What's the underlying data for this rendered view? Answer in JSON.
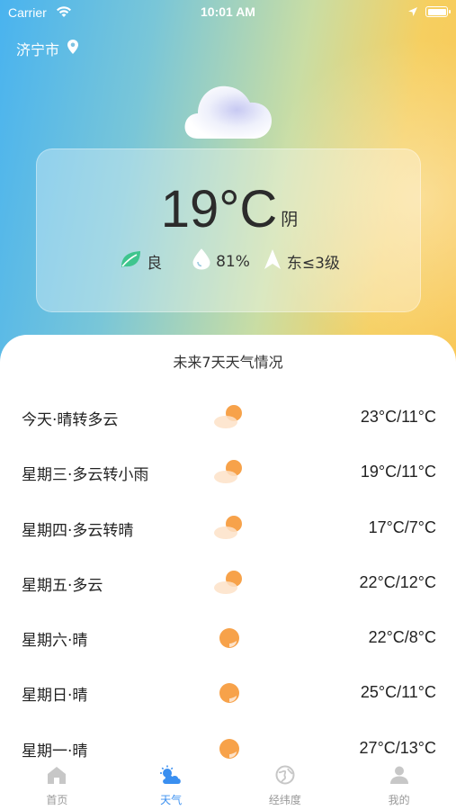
{
  "status_bar": {
    "carrier": "Carrier",
    "time": "10:01 AM"
  },
  "location": {
    "city": "济宁市",
    "icon": "location-pin-icon"
  },
  "current": {
    "temperature": "19°C",
    "condition": "阴",
    "air_quality": "良",
    "humidity": "81%",
    "wind": "东≤3级",
    "icon": "cloud-icon"
  },
  "forecast": {
    "title": "未来7天天气情况",
    "days": [
      {
        "label": "今天·晴转多云",
        "temps": "23°C/11°C",
        "icon": "sun-cloud-icon"
      },
      {
        "label": "星期三·多云转小雨",
        "temps": "19°C/11°C",
        "icon": "sun-cloud-icon"
      },
      {
        "label": "星期四·多云转晴",
        "temps": "17°C/7°C",
        "icon": "sun-cloud-icon"
      },
      {
        "label": "星期五·多云",
        "temps": "22°C/12°C",
        "icon": "sun-cloud-icon"
      },
      {
        "label": "星期六·晴",
        "temps": "22°C/8°C",
        "icon": "sun-icon"
      },
      {
        "label": "星期日·晴",
        "temps": "25°C/11°C",
        "icon": "sun-icon"
      },
      {
        "label": "星期一·晴",
        "temps": "27°C/13°C",
        "icon": "sun-icon"
      }
    ]
  },
  "tabbar": {
    "tabs": [
      {
        "label": "首页",
        "icon": "home-icon",
        "active": false
      },
      {
        "label": "天气",
        "icon": "weather-icon",
        "active": true
      },
      {
        "label": "经纬度",
        "icon": "globe-icon",
        "active": false
      },
      {
        "label": "我的",
        "icon": "user-icon",
        "active": false
      }
    ]
  },
  "colors": {
    "accent": "#3a8ff0",
    "gradient_start": "#49b3ef",
    "gradient_end": "#f9c756",
    "inactive_tab": "#999999"
  }
}
